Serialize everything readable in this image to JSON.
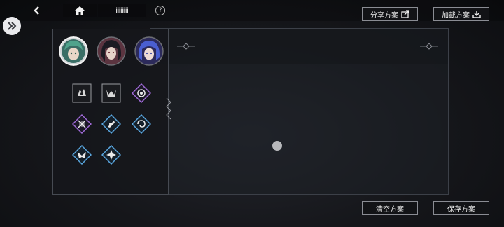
{
  "topbar": {
    "back": "back-arrow",
    "home": "home-icon",
    "title": "iiiiiiiiii",
    "help": "?"
  },
  "toolbar": {
    "share_label": "分享方案",
    "load_label": "加載方案"
  },
  "footer": {
    "clear_label": "清空方案",
    "save_label": "保存方案"
  },
  "characters": [
    {
      "name": "green-hair-character",
      "selected": true
    },
    {
      "name": "dark-hair-character",
      "selected": false
    },
    {
      "name": "blue-hair-character",
      "selected": false
    }
  ],
  "skill_icons": [
    {
      "name": "skill-icon-1",
      "shape": "square",
      "color": "#d8d8d8"
    },
    {
      "name": "skill-icon-2",
      "shape": "square",
      "color": "#d8d8d8"
    },
    {
      "name": "skill-icon-3",
      "shape": "diamond",
      "color": "#a06ad8"
    },
    {
      "name": "skill-icon-4",
      "shape": "diamond",
      "color": "#a06ad8"
    },
    {
      "name": "skill-icon-5",
      "shape": "diamond",
      "color": "#5aa7e0"
    },
    {
      "name": "skill-icon-6",
      "shape": "diamond",
      "color": "#5aa7e0"
    },
    {
      "name": "skill-icon-7",
      "shape": "diamond",
      "color": "#5aa7e0"
    },
    {
      "name": "skill-icon-8",
      "shape": "diamond",
      "color": "#5aa7e0"
    }
  ],
  "colors": {
    "panel_border": "#464a52",
    "purple_frame": "#a06ad8",
    "blue_frame": "#5aa7e0"
  }
}
